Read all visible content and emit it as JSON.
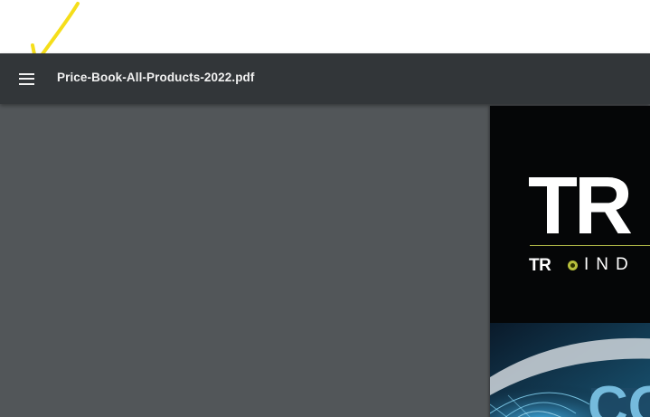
{
  "toolbar": {
    "document_title": "Price-Book-All-Products-2022.pdf",
    "menu_icon": "hamburger-menu-icon",
    "background_color": "#323639"
  },
  "annotation": {
    "icon": "yellow-arrow-icon",
    "color": "#f5de1a"
  },
  "viewer": {
    "background_color": "#525659"
  },
  "pdf_page": {
    "brand_large": "TR",
    "brand_small": "TR",
    "brand_tagline": "IND",
    "cover_text": "CO",
    "accent_color": "#b7bf3c"
  }
}
